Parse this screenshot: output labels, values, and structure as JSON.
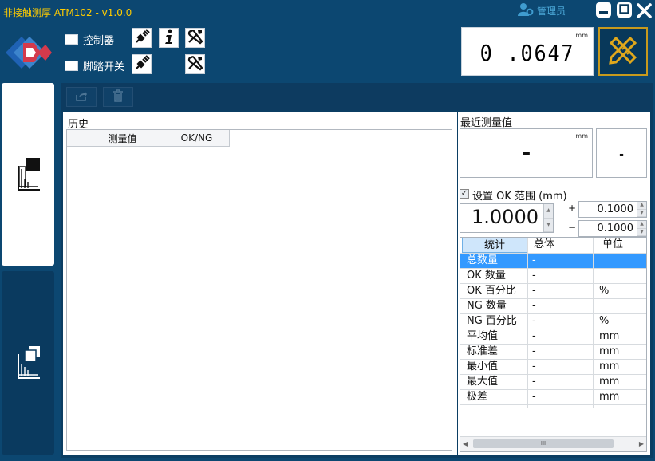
{
  "app": {
    "title": "非接触测厚 ATM102 - v1.0.0"
  },
  "user": {
    "label": "管理员",
    "icon": "user-gear-icon"
  },
  "window_controls": {
    "minimize": "minimize-icon",
    "maximize": "maximize-icon",
    "close": "close-icon"
  },
  "controls": {
    "controller_label": "控制器",
    "footswitch_label": "脚踏开关"
  },
  "readout": {
    "unit": "mm",
    "value": "0 .0647"
  },
  "actions": {
    "export_icon": "export-icon",
    "delete_icon": "trash-icon"
  },
  "history": {
    "title": "历史",
    "columns": [
      "",
      "测量值",
      "OK/NG"
    ],
    "rows": []
  },
  "recent": {
    "title": "最近测量值",
    "unit": "mm",
    "value": "-",
    "status": "-"
  },
  "ok_range": {
    "checked": true,
    "label": "设置 OK 范围 (mm)",
    "nominal": "1.0000",
    "plus_sign": "+",
    "minus_sign": "−",
    "upper_tol": "0.1000",
    "lower_tol": "0.1000"
  },
  "stats": {
    "headers": [
      "统计",
      "总体",
      "单位"
    ],
    "rows": [
      {
        "name": "总数量",
        "value": "-",
        "unit": ""
      },
      {
        "name": "OK 数量",
        "value": "-",
        "unit": ""
      },
      {
        "name": "OK 百分比",
        "value": "-",
        "unit": "%"
      },
      {
        "name": "NG 数量",
        "value": "-",
        "unit": ""
      },
      {
        "name": "NG 百分比",
        "value": "-",
        "unit": "%"
      },
      {
        "name": "平均值",
        "value": "-",
        "unit": "mm"
      },
      {
        "name": "标准差",
        "value": "-",
        "unit": "mm"
      },
      {
        "name": "最小值",
        "value": "-",
        "unit": "mm"
      },
      {
        "name": "最大值",
        "value": "-",
        "unit": "mm"
      },
      {
        "name": "极差",
        "value": "-",
        "unit": "mm"
      }
    ],
    "scroll_glyph": "III",
    "selected_row": 0
  },
  "colors": {
    "title": "#ffcc00",
    "background": "#0c4771",
    "selection": "#3399ff",
    "pencil_border": "#c79a1d"
  }
}
